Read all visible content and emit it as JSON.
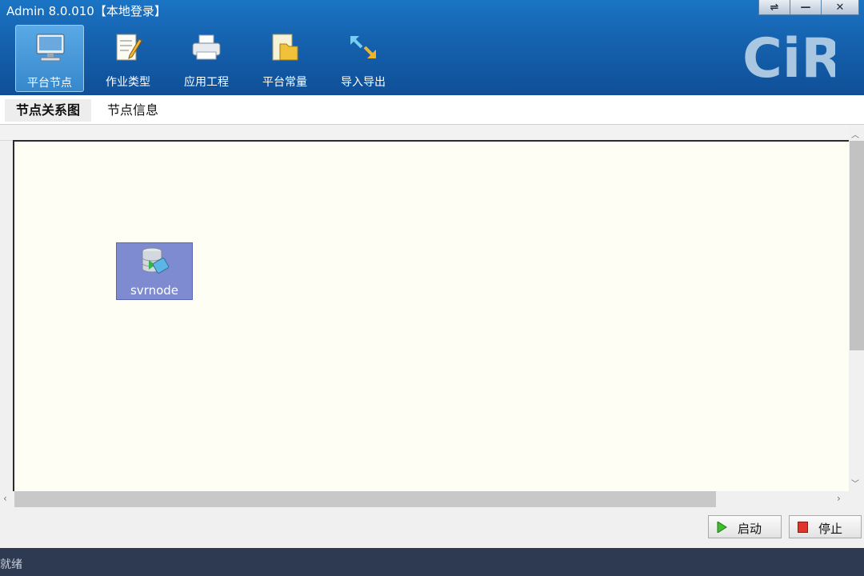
{
  "window": {
    "title": "Admin 8.0.010【本地登录】",
    "controls": [
      "⇌",
      "—",
      "✕"
    ]
  },
  "toolbar": {
    "items": [
      {
        "label": "平台节点",
        "icon": "computer-icon",
        "active": true
      },
      {
        "label": "作业类型",
        "icon": "edit-document-icon",
        "active": false
      },
      {
        "label": "应用工程",
        "icon": "printer-icon",
        "active": false
      },
      {
        "label": "平台常量",
        "icon": "folder-icon",
        "active": false
      },
      {
        "label": "导入导出",
        "icon": "import-export-arrows-icon",
        "active": false
      }
    ],
    "logo_text": "CiR"
  },
  "tabs": [
    {
      "label": "节点关系图",
      "active": true
    },
    {
      "label": "节点信息",
      "active": false
    }
  ],
  "canvas": {
    "nodes": [
      {
        "label": "svrnode",
        "icon": "database-server-icon"
      }
    ]
  },
  "actions": {
    "start_label": "启动",
    "stop_label": "停止"
  },
  "colors": {
    "header": "#1561ad",
    "node_fill": "#7f8bd1",
    "canvas_bg": "#fffef5",
    "start_icon": "#3cbf2b",
    "stop_icon": "#e0352b",
    "status_bar": "#2d3a51"
  },
  "status": {
    "text": "就绪"
  }
}
